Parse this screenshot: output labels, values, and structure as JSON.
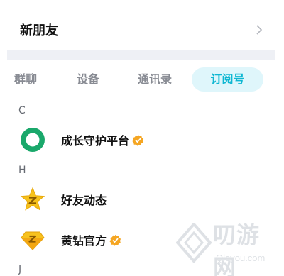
{
  "new_friends": {
    "label": "新朋友"
  },
  "tabs": [
    {
      "label": "群聊",
      "active": false
    },
    {
      "label": "设备",
      "active": false
    },
    {
      "label": "通讯录",
      "active": false
    },
    {
      "label": "订阅号",
      "active": true
    }
  ],
  "sections": [
    {
      "letter": "C",
      "items": [
        {
          "name": "成长守护平台",
          "icon": "growth-guard-icon",
          "verified": true
        }
      ]
    },
    {
      "letter": "H",
      "items": [
        {
          "name": "好友动态",
          "icon": "qzone-star-icon",
          "verified": false
        },
        {
          "name": "黄钻官方",
          "icon": "yellow-diamond-icon",
          "verified": true
        }
      ]
    },
    {
      "letter": "J",
      "items": []
    }
  ],
  "watermark": {
    "text": "叨游网",
    "sub": "Qleyou.com"
  },
  "colors": {
    "accent": "#0fb7d2",
    "tab_active_bg": "#dff6fb",
    "verified_badge": "#f5a623",
    "growth_green": "#1aa86b"
  }
}
